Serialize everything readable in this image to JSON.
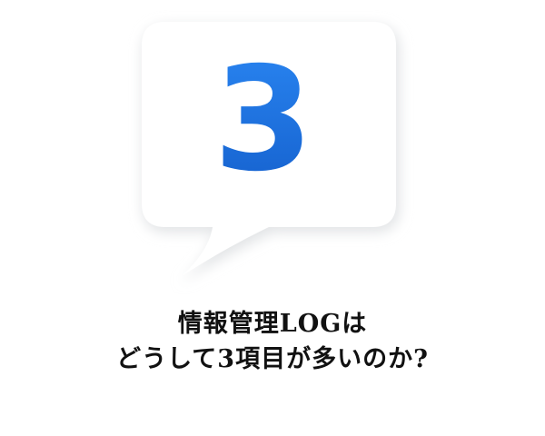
{
  "bubble": {
    "number": "3",
    "number_color": "#1a6fe0",
    "fill_color": "#ffffff",
    "shadow_color": "#e2e4e6"
  },
  "caption": {
    "line1": "情報管理LOGは",
    "line2": "どうして3項目が多いのか?"
  }
}
